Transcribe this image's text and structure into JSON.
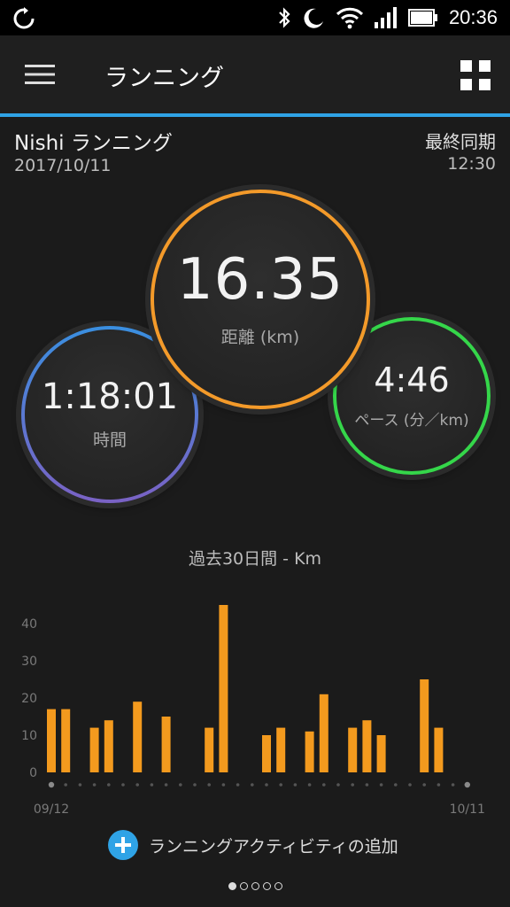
{
  "status_bar": {
    "time": "20:36",
    "icons": [
      "sync-icon",
      "bluetooth-icon",
      "moon-icon",
      "wifi-icon",
      "signal-icon",
      "battery-icon"
    ]
  },
  "app_bar": {
    "title": "ランニング",
    "menu_icon": "hamburger-menu-icon",
    "grid_icon": "grid-view-icon",
    "accent": "#2fa3e6"
  },
  "activity": {
    "name": "Nishi ランニング",
    "date": "2017/10/11",
    "sync_label": "最終同期",
    "sync_time": "12:30"
  },
  "stats": {
    "time": {
      "value": "1:18:01",
      "label": "時間"
    },
    "distance": {
      "value": "16.35",
      "label": "距離 (km)",
      "color": "#f39a2a"
    },
    "pace": {
      "value": "4:46",
      "label": "ペース (分／km)",
      "color": "#35d64a"
    }
  },
  "chart_data": {
    "type": "bar",
    "title": "過去30日間 - Km",
    "x_start_label": "09/12",
    "x_end_label": "10/11",
    "ylim": [
      0,
      45
    ],
    "yticks": [
      0,
      10,
      20,
      30,
      40
    ],
    "bar_color": "#f39a1e",
    "values": [
      17,
      17,
      0,
      12,
      14,
      0,
      19,
      0,
      15,
      0,
      0,
      12,
      45,
      0,
      0,
      10,
      12,
      0,
      11,
      21,
      0,
      12,
      14,
      10,
      0,
      0,
      25,
      12,
      0,
      0
    ]
  },
  "add_activity": {
    "label": "ランニングアクティビティの追加",
    "icon": "add-circle-icon"
  },
  "pager": {
    "count": 5,
    "active": 0
  }
}
